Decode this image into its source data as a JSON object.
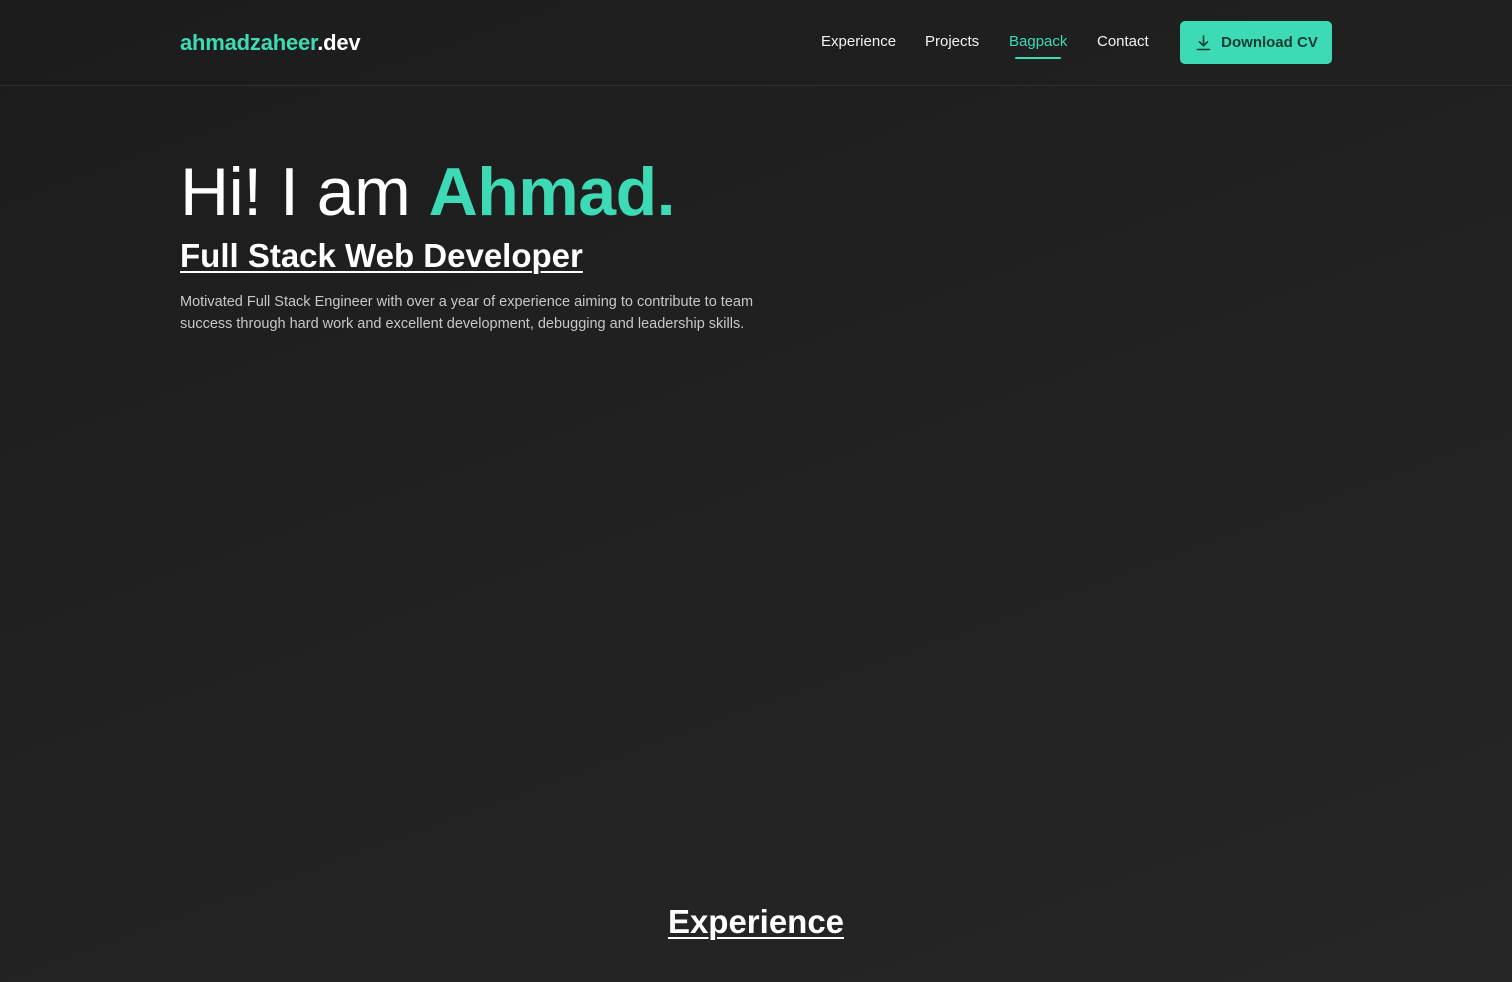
{
  "header": {
    "logo_name": "ahmadzaheer",
    "logo_tld": ".dev",
    "nav": [
      {
        "label": "Experience",
        "active": false
      },
      {
        "label": "Projects",
        "active": false
      },
      {
        "label": "Bagpack",
        "active": true
      },
      {
        "label": "Contact",
        "active": false
      }
    ],
    "cta": {
      "label": "Download CV",
      "icon": "download-icon"
    }
  },
  "hero": {
    "greeting": "Hi! I am ",
    "name": "Ahmad.",
    "role": "Full Stack Web Developer",
    "bio": "Motivated Full Stack Engineer with over a year of experience aiming to contribute to team success through hard work and excellent development, debugging and leadership skills."
  },
  "sections": {
    "experience_heading": "Experience"
  },
  "colors": {
    "accent": "#3ddbb5",
    "background": "#212121",
    "text": "#ffffff",
    "muted_text": "#c8c8c8"
  }
}
